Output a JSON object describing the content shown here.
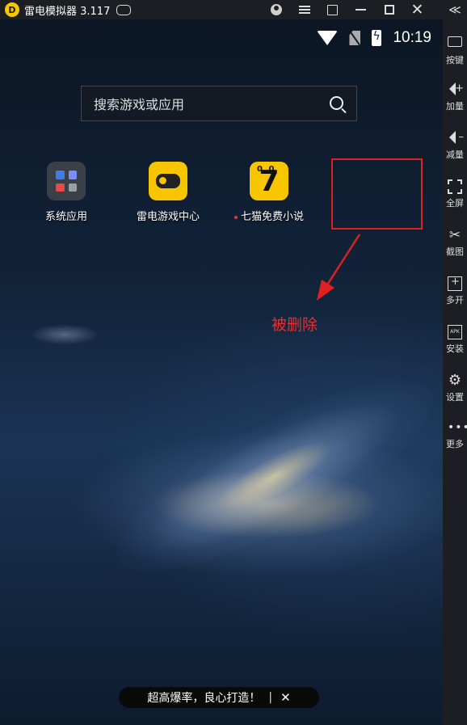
{
  "window": {
    "title": "雷电模拟器 3.117",
    "logo_char": "D"
  },
  "status_bar": {
    "time": "10:19"
  },
  "search": {
    "placeholder": "搜索游戏或应用"
  },
  "apps": [
    {
      "label": "系统应用",
      "icon": "folder-icon"
    },
    {
      "label": "雷电游戏中心",
      "icon": "gamepad-icon"
    },
    {
      "label": "七猫免费小说",
      "icon": "cat-seven-icon",
      "icon_text": "7",
      "has_new_dot": true
    }
  ],
  "annotation": {
    "label": "被删除",
    "color": "#e02020"
  },
  "ad_banner": {
    "text": "超高爆率，良心打造！",
    "separator": "|",
    "close": "✕"
  },
  "sidebar": {
    "collapse": "≪",
    "items": [
      {
        "label": "按键",
        "icon": "keyboard-icon"
      },
      {
        "label": "加量",
        "icon": "volume-up-icon"
      },
      {
        "label": "减量",
        "icon": "volume-down-icon"
      },
      {
        "label": "全屏",
        "icon": "fullscreen-icon"
      },
      {
        "label": "截图",
        "icon": "screenshot-icon"
      },
      {
        "label": "多开",
        "icon": "multi-instance-icon"
      },
      {
        "label": "安装",
        "icon": "apk-install-icon"
      },
      {
        "label": "设置",
        "icon": "settings-icon"
      },
      {
        "label": "更多",
        "icon": "more-icon"
      }
    ]
  },
  "colors": {
    "accent": "#f7c600",
    "titlebar": "#1c1e24",
    "annotation_red": "#e02020"
  }
}
